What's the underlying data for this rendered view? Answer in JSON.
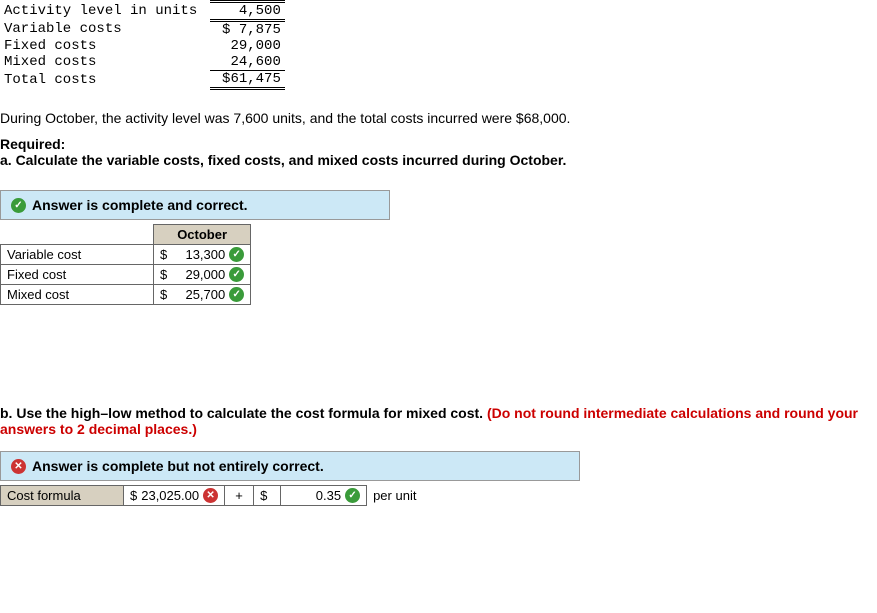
{
  "given": {
    "rows": [
      {
        "label": "Activity level in units",
        "value": "4,500",
        "style": "dbl-under"
      },
      {
        "label": "Variable costs",
        "value": "$ 7,875",
        "style": ""
      },
      {
        "label": "Fixed costs",
        "value": "29,000",
        "style": ""
      },
      {
        "label": "Mixed costs",
        "value": "24,600",
        "style": "sgl-under"
      },
      {
        "label": "Total costs",
        "value": "$61,475",
        "style": "dbl-bottom"
      }
    ]
  },
  "narrative": "During October, the activity level was 7,600 units, and the total costs incurred were $68,000.",
  "required_label": "Required:",
  "part_a": "a. Calculate the variable costs, fixed costs, and mixed costs incurred during October.",
  "banner_a": "Answer is complete and correct.",
  "table_a": {
    "col_header": "October",
    "rows": [
      {
        "label": "Variable cost",
        "value": "13,300",
        "correct": true
      },
      {
        "label": "Fixed cost",
        "value": "29,000",
        "correct": true
      },
      {
        "label": "Mixed cost",
        "value": "25,700",
        "correct": true
      }
    ]
  },
  "part_b_lead": "b. Use the high–low method to calculate the cost formula for mixed cost. ",
  "part_b_red": "(Do not round intermediate calculations and round your answers to 2 decimal places.)",
  "banner_b": "Answer is complete but not entirely correct.",
  "formula": {
    "label": "Cost formula",
    "fixed": "23,025.00",
    "fixed_correct": false,
    "plus": "+",
    "variable": "0.35",
    "variable_correct": true,
    "unit_suffix": "per unit",
    "dollar": "$"
  }
}
